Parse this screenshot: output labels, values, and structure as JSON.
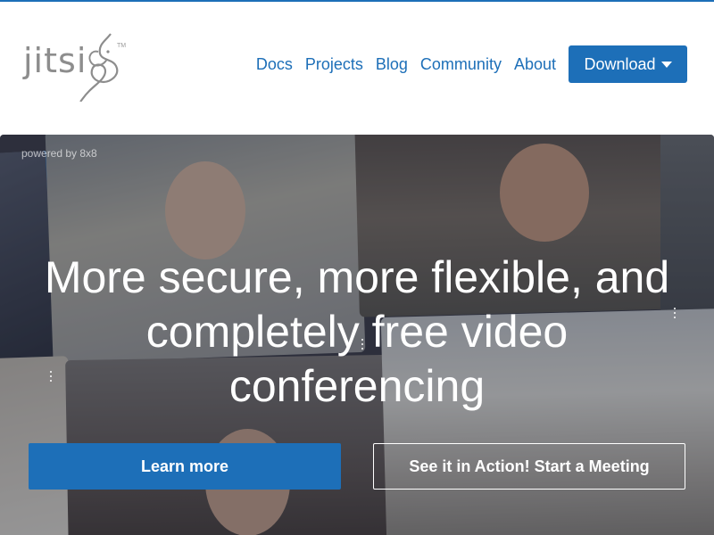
{
  "brand": {
    "name": "jitsi",
    "trademark": "TM"
  },
  "nav": {
    "links": [
      "Docs",
      "Projects",
      "Blog",
      "Community",
      "About"
    ],
    "download_label": "Download"
  },
  "hero": {
    "powered_by": "powered by 8x8",
    "headline": "More secure, more flexible, and completely free video conferencing",
    "primary_cta": "Learn more",
    "secondary_cta": "See it in Action! Start a Meeting"
  },
  "colors": {
    "accent": "#1d6fb8",
    "logo_gray": "#8d8d8d",
    "text_on_hero": "#ffffff"
  }
}
